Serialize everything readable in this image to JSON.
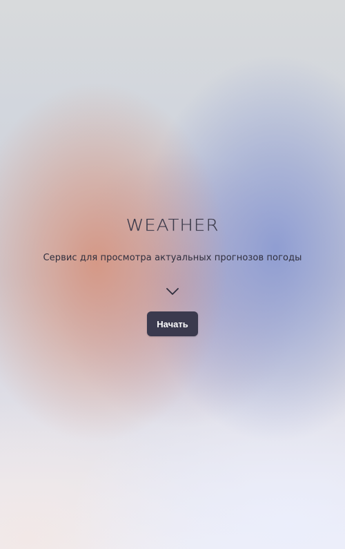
{
  "hero": {
    "logo_text": "WEATHER",
    "subtitle": "Сервис для просмотра актуальных прогнозов погоды",
    "scroll_icon": "chevron-down-icon",
    "start_button_label": "Начать"
  },
  "colors": {
    "button_bg": "#3b3a4e",
    "button_text": "#ffffff",
    "text_primary": "#2f2e3d",
    "blob_warm": "#d6968a",
    "blob_cool": "#8c9bd2"
  }
}
